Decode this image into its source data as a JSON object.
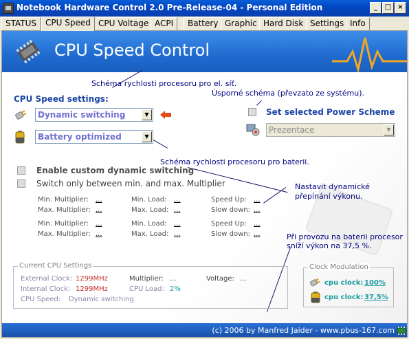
{
  "window": {
    "title": "Notebook Hardware Control 2.0 Pre-Release-04 - Personal Edition",
    "minimize": "_",
    "maximize": "□",
    "close": "×"
  },
  "tabs": [
    "STATUS",
    "CPU Speed",
    "CPU Voltage",
    "ACPI",
    "Battery",
    "Graphic",
    "Hard Disk",
    "Settings",
    "Info"
  ],
  "active_tab": "CPU Speed",
  "header": {
    "title": "CPU Speed Control"
  },
  "annotations": {
    "ac_scheme": "Schéma rychlosti procesoru pro el. síť.",
    "power_scheme": "Úsporné schéma (převzato ze systému).",
    "battery_scheme": "Schéma rychlosti procesoru pro baterii.",
    "dynamic_1": "Nastavit dynamické",
    "dynamic_2": "přepínání výkonu.",
    "battery_info_1": "Při provozu na baterii procesor",
    "battery_info_2": "sníží výkon na 37,5 %."
  },
  "cpu_speed_settings": {
    "label": "CPU Speed settings:",
    "ac_value": "Dynamic switching",
    "battery_value": "Battery optimized"
  },
  "power_scheme": {
    "label": "Set selected Power Scheme",
    "value": "Prezentace"
  },
  "custom": {
    "enable_label": "Enable custom dynamic switching",
    "switch_label": "Switch only between min. and max. Multiplier"
  },
  "multiplier_rows": [
    {
      "c1": "Min. Multiplier:",
      "v1": "...",
      "c2": "Min. Load:",
      "v2": "...",
      "c3": "Speed Up:",
      "v3": "..."
    },
    {
      "c1": "Max. Multiplier:",
      "v1": "...",
      "c2": "Max. Load:",
      "v2": "...",
      "c3": "Slow down:",
      "v3": "..."
    },
    {
      "c1": "Min. Multiplier:",
      "v1": "...",
      "c2": "Min. Load:",
      "v2": "...",
      "c3": "Speed Up:",
      "v3": "..."
    },
    {
      "c1": "Max. Multiplier:",
      "v1": "...",
      "c2": "Max. Load:",
      "v2": "...",
      "c3": "Slow down:",
      "v3": "..."
    }
  ],
  "current": {
    "title": "Current CPU Settings",
    "external_label": "External Clock:",
    "external_value": "1299MHz",
    "internal_label": "Internal Clock:",
    "internal_value": "1299MHz",
    "multiplier_label": "Multiplier:",
    "multiplier_value": "...",
    "voltage_label": "Voltage:",
    "voltage_value": "...",
    "load_label": "CPU Load:",
    "load_value": "2%",
    "speed_label": "CPU Speed:",
    "speed_value": "Dynamic switching"
  },
  "clock_modulation": {
    "title": "Clock Modulation",
    "ac_label": "cpu clock:",
    "ac_value": "100%",
    "battery_label": "cpu clock:",
    "battery_value": "37,5%"
  },
  "footer": {
    "text": "(c) 2006 by Manfred Jaider - www.pbus-167.com"
  },
  "colors": {
    "title_bar": "#0247c4",
    "header": "#1f6bd0",
    "accent_orange": "#f5a623",
    "link": "#1a9ca0"
  }
}
